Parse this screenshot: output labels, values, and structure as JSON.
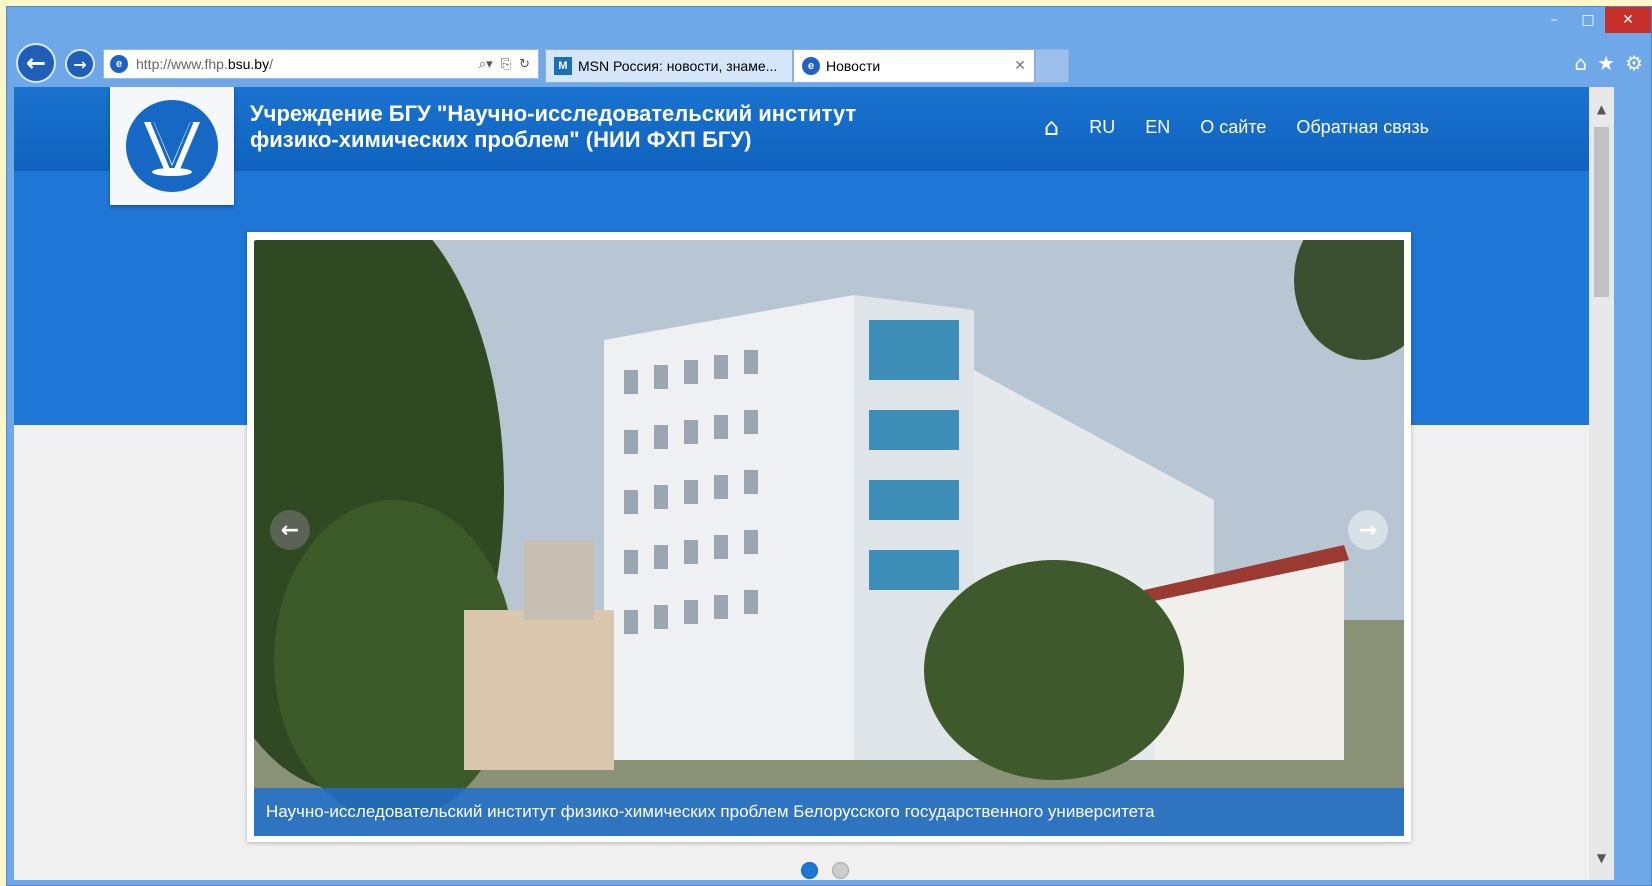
{
  "browser": {
    "window_controls": {
      "minimize": "–",
      "maximize": "□",
      "close": "✕"
    },
    "nav": {
      "back": "←",
      "forward": "→"
    },
    "address": {
      "prefix": "http://www.fhp.",
      "host": "bsu.by",
      "suffix": "/"
    },
    "address_tools": [
      "⌕▾",
      "⎘",
      "↻"
    ],
    "tabs": [
      {
        "label": "MSN Россия: новости, знаме...",
        "icon": "msn-icon"
      },
      {
        "label": "Новости",
        "icon": "ie-icon",
        "close": "✕"
      }
    ],
    "right_icons": {
      "home": "⌂",
      "favorites": "★",
      "settings": "⚙"
    }
  },
  "site": {
    "title_line1": "Учреждение БГУ \"Научно-исследовательский институт",
    "title_line2": "физико-химических проблем\" (НИИ ФХП БГУ)",
    "nav": {
      "home": "⌂",
      "ru": "RU",
      "en": "EN",
      "about": "О сайте",
      "feedback": "Обратная связь"
    },
    "slider": {
      "caption": "Научно-исследовательский институт физико-химических проблем Белорусского государственного университета",
      "prev": "←",
      "next": "→",
      "active_slide": 1,
      "slide_count": 2
    }
  },
  "scrollbar": {
    "up": "▲",
    "down": "▼"
  },
  "colors": {
    "accent": "#1e76d6",
    "header": "#0f63bf",
    "close": "#c7302a"
  }
}
